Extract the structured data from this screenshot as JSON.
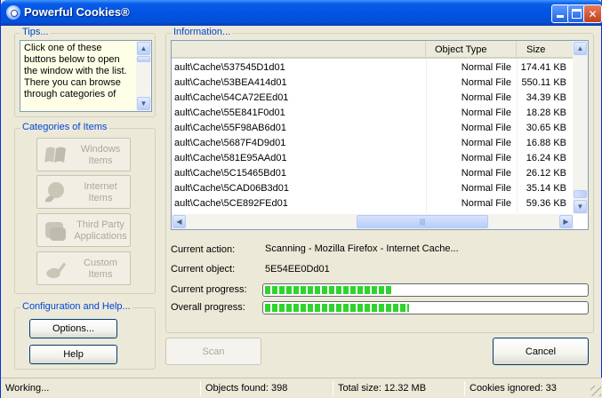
{
  "window": {
    "title": "Powerful Cookies®"
  },
  "tips": {
    "label": "Tips...",
    "lines": [
      "Click one of these",
      "buttons below to open",
      "the window with the list.",
      "There you can browse",
      "through categories of"
    ]
  },
  "categories": {
    "label": "Categories of Items",
    "items": [
      {
        "line1": "Windows",
        "line2": "Items",
        "icon": "windows-icon"
      },
      {
        "line1": "Internet",
        "line2": "Items",
        "icon": "internet-icon"
      },
      {
        "line1": "Third Party",
        "line2": "Applications",
        "icon": "third-party-icon"
      },
      {
        "line1": "Custom",
        "line2": "Items",
        "icon": "custom-icon"
      }
    ]
  },
  "config": {
    "label": "Configuration and Help...",
    "options_label": "Options...",
    "help_label": "Help"
  },
  "info": {
    "label": "Information...",
    "columns": {
      "name": "",
      "type": "Object Type",
      "size": "Size"
    },
    "rows": [
      {
        "name": "ault\\Cache\\537545D1d01",
        "type": "Normal File",
        "size": "174.41 KB"
      },
      {
        "name": "ault\\Cache\\53BEA414d01",
        "type": "Normal File",
        "size": "550.11 KB"
      },
      {
        "name": "ault\\Cache\\54CA72EEd01",
        "type": "Normal File",
        "size": "34.39 KB"
      },
      {
        "name": "ault\\Cache\\55E841F0d01",
        "type": "Normal File",
        "size": "18.28 KB"
      },
      {
        "name": "ault\\Cache\\55F98AB6d01",
        "type": "Normal File",
        "size": "30.65 KB"
      },
      {
        "name": "ault\\Cache\\5687F4D9d01",
        "type": "Normal File",
        "size": "16.88 KB"
      },
      {
        "name": "ault\\Cache\\581E95AAd01",
        "type": "Normal File",
        "size": "16.24 KB"
      },
      {
        "name": "ault\\Cache\\5C15465Bd01",
        "type": "Normal File",
        "size": "26.12 KB"
      },
      {
        "name": "ault\\Cache\\5CAD06B3d01",
        "type": "Normal File",
        "size": "35.14 KB"
      },
      {
        "name": "ault\\Cache\\5CE892FEd01",
        "type": "Normal File",
        "size": "59.36 KB"
      }
    ]
  },
  "status": {
    "current_action_label": "Current action:",
    "current_action_value": "Scanning - Mozilla Firefox - Internet Cache...",
    "current_object_label": "Current object:",
    "current_object_value": "5E54EE0Dd01",
    "current_progress_label": "Current progress:",
    "current_progress": 0.4,
    "overall_progress_label": "Overall progress:",
    "overall_progress": 0.45
  },
  "buttons": {
    "scan_label": "Scan",
    "cancel_label": "Cancel"
  },
  "statusbar": {
    "state": "Working...",
    "objects_found": "Objects found: 398",
    "total_size": "Total size: 12.32 MB",
    "cookies_ignored": "Cookies ignored: 33"
  },
  "colors": {
    "accent": "#0046d5",
    "titlebar": "#0054e3",
    "progress": "#2ed42e"
  }
}
